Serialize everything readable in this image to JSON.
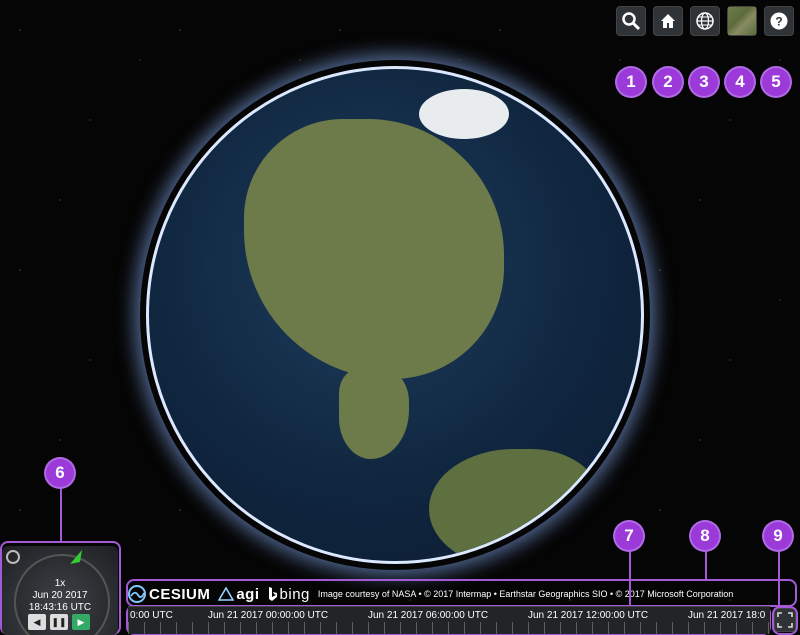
{
  "toolbar": {
    "items": [
      {
        "icon": "search-icon",
        "badge": "1"
      },
      {
        "icon": "home-icon",
        "badge": "2"
      },
      {
        "icon": "globe-icon",
        "badge": "3"
      },
      {
        "icon": "base-layer-thumbnail",
        "badge": "4"
      },
      {
        "icon": "help-icon",
        "badge": "5"
      }
    ]
  },
  "animation": {
    "badge": "6",
    "speed": "1x",
    "date": "Jun 20 2017",
    "time": "18:43:16 UTC",
    "rewind": "◀",
    "pause": "❚❚",
    "play": "▶"
  },
  "credits": {
    "badge": "8",
    "cesium": "CESIUM",
    "agi": "agi",
    "bing": "bing",
    "text": "Image courtesy of NASA • © 2017 Intermap • Earthstar Geographics SIO • © 2017 Microsoft Corporation"
  },
  "timeline": {
    "badge": "7",
    "labels": [
      "0:00 UTC",
      "Jun 21 2017 00:00:00 UTC",
      "Jun 21 2017 06:00:00 UTC",
      "Jun 21 2017 12:00:00 UTC",
      "Jun 21 2017 18:0"
    ]
  },
  "fullscreen": {
    "badge": "9"
  },
  "colors": {
    "badge": "#9b3ad8",
    "toolbar_button": "#303336"
  }
}
